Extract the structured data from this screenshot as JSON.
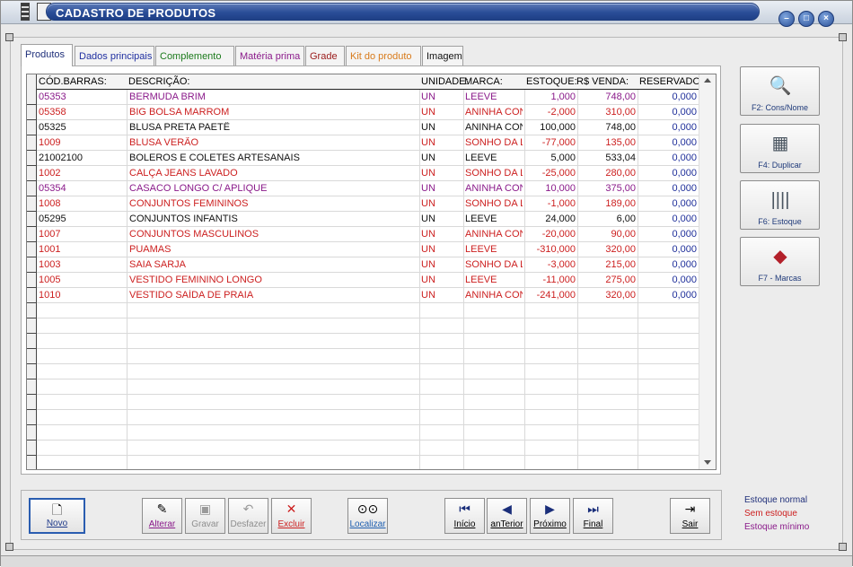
{
  "window": {
    "title": "CADASTRO DE PRODUTOS"
  },
  "tabs": [
    {
      "label": "Produtos",
      "color": "#1f2f7a"
    },
    {
      "label": "Dados principais",
      "color": "#1f2fa0"
    },
    {
      "label": "Complemento",
      "color": "#1c7a1c"
    },
    {
      "label": "Matéria prima",
      "color": "#8a1a8a"
    },
    {
      "label": "Grade",
      "color": "#9a1a1a"
    },
    {
      "label": "Kit do produto",
      "color": "#d87a1a"
    },
    {
      "label": "Imagem",
      "color": "#111111"
    }
  ],
  "grid": {
    "columns": [
      "CÓD.BARRAS:",
      "DESCRIÇÃO:",
      "UNIDADE:",
      "MARCA:",
      "ESTOQUE:",
      "R$ VENDA:",
      "RESERVADO"
    ],
    "rows": [
      {
        "codigo": "05353",
        "descricao": "BERMUDA BRIM",
        "unidade": "UN",
        "marca": "LEEVE",
        "estoque": "1,000",
        "venda": "748,00",
        "reservado": "0,000",
        "status": "minimo"
      },
      {
        "codigo": "05358",
        "descricao": "BIG BOLSA MARROM",
        "unidade": "UN",
        "marca": "ANINHA CON",
        "estoque": "-2,000",
        "venda": "310,00",
        "reservado": "0,000",
        "status": "sem"
      },
      {
        "codigo": "05325",
        "descricao": "BLUSA PRETA PAETÊ",
        "unidade": "UN",
        "marca": "ANINHA CON",
        "estoque": "100,000",
        "venda": "748,00",
        "reservado": "0,000",
        "status": "normal"
      },
      {
        "codigo": "1009",
        "descricao": "BLUSA VERÃO",
        "unidade": "UN",
        "marca": "SONHO DA L",
        "estoque": "-77,000",
        "venda": "135,00",
        "reservado": "0,000",
        "status": "sem"
      },
      {
        "codigo": "21002100",
        "descricao": "BOLEROS E COLETES ARTESANAIS",
        "unidade": "UN",
        "marca": "LEEVE",
        "estoque": "5,000",
        "venda": "533,04",
        "reservado": "0,000",
        "status": "normal"
      },
      {
        "codigo": "1002",
        "descricao": "CALÇA JEANS LAVADO",
        "unidade": "UN",
        "marca": "SONHO DA L",
        "estoque": "-25,000",
        "venda": "280,00",
        "reservado": "0,000",
        "status": "sem"
      },
      {
        "codigo": "05354",
        "descricao": "CASACO LONGO C/ APLIQUE",
        "unidade": "UN",
        "marca": "ANINHA CON",
        "estoque": "10,000",
        "venda": "375,00",
        "reservado": "0,000",
        "status": "minimo"
      },
      {
        "codigo": "1008",
        "descricao": "CONJUNTOS FEMININOS",
        "unidade": "UN",
        "marca": "SONHO DA L",
        "estoque": "-1,000",
        "venda": "189,00",
        "reservado": "0,000",
        "status": "sem"
      },
      {
        "codigo": "05295",
        "descricao": "CONJUNTOS INFANTIS",
        "unidade": "UN",
        "marca": "LEEVE",
        "estoque": "24,000",
        "venda": "6,00",
        "reservado": "0,000",
        "status": "normal"
      },
      {
        "codigo": "1007",
        "descricao": "CONJUNTOS MASCULINOS",
        "unidade": "UN",
        "marca": "ANINHA CON",
        "estoque": "-20,000",
        "venda": "90,00",
        "reservado": "0,000",
        "status": "sem"
      },
      {
        "codigo": "1001",
        "descricao": "PUAMAS",
        "unidade": "UN",
        "marca": "LEEVE",
        "estoque": "-310,000",
        "venda": "320,00",
        "reservado": "0,000",
        "status": "sem"
      },
      {
        "codigo": "1003",
        "descricao": "SAIA SARJA",
        "unidade": "UN",
        "marca": "SONHO DA L",
        "estoque": "-3,000",
        "venda": "215,00",
        "reservado": "0,000",
        "status": "sem"
      },
      {
        "codigo": "1005",
        "descricao": "VESTIDO FEMININO LONGO",
        "unidade": "UN",
        "marca": "LEEVE",
        "estoque": "-11,000",
        "venda": "275,00",
        "reservado": "0,000",
        "status": "sem"
      },
      {
        "codigo": "1010",
        "descricao": "VESTIDO SAÍDA DE PRAIA",
        "unidade": "UN",
        "marca": "ANINHA CON",
        "estoque": "-241,000",
        "venda": "320,00",
        "reservado": "0,000",
        "status": "sem"
      }
    ],
    "reservado_color": "#1f2f9a"
  },
  "status_colors": {
    "normal": "#111111",
    "sem": "#cc1f1f",
    "minimo": "#8a1a8a"
  },
  "side_buttons": [
    {
      "label": "F2: Cons/Nome",
      "icon": "magnifier-window-icon"
    },
    {
      "label": "F4: Duplicar",
      "icon": "box-icon"
    },
    {
      "label": "F6: Estoque",
      "icon": "barcode-icon"
    },
    {
      "label": "F7 - Marcas",
      "icon": "tag-icon"
    }
  ],
  "toolbar": {
    "novo": "Novo",
    "alterar": "Alterar",
    "gravar": "Gravar",
    "desfazer": "Desfazer",
    "excluir": "Excluir",
    "localizar": "Localizar",
    "inicio": "Início",
    "anterior": "anTerior",
    "proximo": "Próximo",
    "final": "Final",
    "sair": "Sair"
  },
  "legend": {
    "normal": "Estoque normal",
    "sem": "Sem estoque",
    "minimo": "Estoque mínimo"
  }
}
